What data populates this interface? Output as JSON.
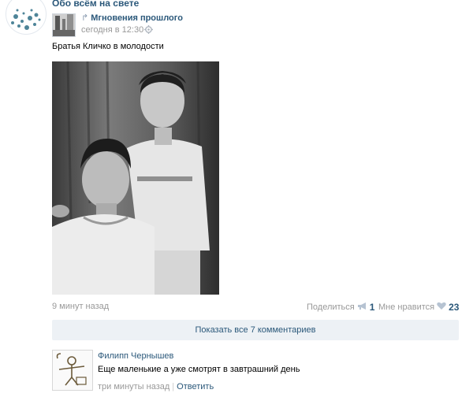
{
  "group": {
    "name": "Обо всём на свете"
  },
  "repost": {
    "source_name": "Мгновения прошлого",
    "time": "сегодня в 12:30"
  },
  "post": {
    "text": "Братья Кличко в молодости",
    "date": "9 минут назад",
    "share_label": "Поделиться",
    "share_count": "1",
    "like_label": "Мне нравится",
    "like_count": "23"
  },
  "comments_bar": {
    "label": "Показать все 7 комментариев"
  },
  "comment": {
    "author": "Филипп Чернышев",
    "text": "Еще маленькие а уже смотрят в завтрашний день",
    "time": "три минуты назад",
    "reply_label": "Ответить"
  },
  "icons": {
    "repost": "repost-arrow-icon",
    "settings": "gear-icon",
    "share": "megaphone-icon",
    "like": "heart-icon"
  },
  "colors": {
    "link": "#2b587a",
    "muted": "#999999",
    "bar_bg": "#edf1f5"
  }
}
